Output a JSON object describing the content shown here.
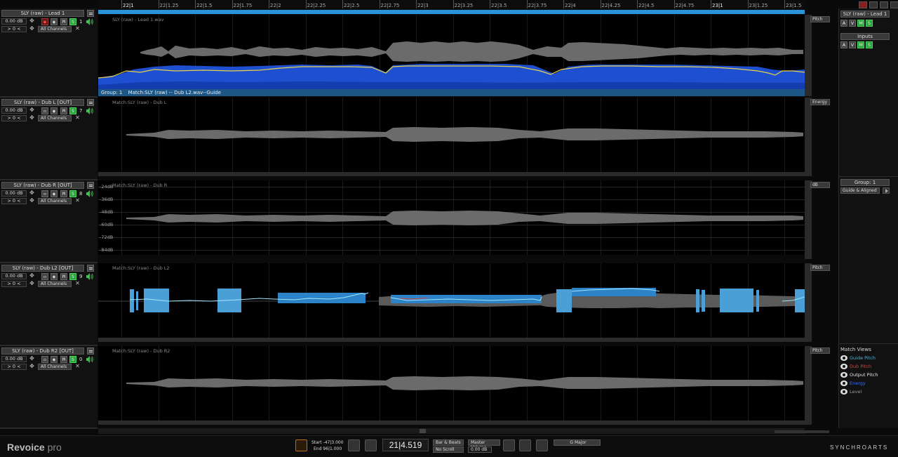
{
  "ruler": {
    "ticks": [
      "22|1",
      "22|1.25",
      "22|1.5",
      "22|1.75",
      "22|2",
      "22|2.25",
      "22|2.5",
      "22|2.75",
      "22|3",
      "22|3.25",
      "22|3.5",
      "22|3.75",
      "22|4",
      "22|4.25",
      "22|4.5",
      "22|4.75",
      "23|1",
      "23|1.25",
      "23|1.5"
    ]
  },
  "tracks": [
    {
      "name": "SLY (raw) - Lead 1",
      "gain": "0.00 dB",
      "pan": "> 0 <",
      "number": "1",
      "channels": "All Channels",
      "caption": "SLY (raw) - Lead 1.wav",
      "view": "Pitch"
    },
    {
      "name": "SLY (raw) - Dub L [OUT]",
      "gain": "0.00 dB",
      "pan": "> 0 <",
      "number": "7",
      "channels": "All Channels",
      "caption": "Match:SLY (raw) - Dub L",
      "view": "Energy"
    },
    {
      "name": "SLY (raw) - Dub R [OUT]",
      "gain": "0.00 dB",
      "pan": "> 0 <",
      "number": "8",
      "channels": "All Channels",
      "caption": "Match:SLY (raw) - Dub R",
      "view": "dB"
    },
    {
      "name": "SLY (raw) - Dub L2 [OUT]",
      "gain": "0.00 dB",
      "pan": "> 0 <",
      "number": "9",
      "channels": "All Channels",
      "caption": "Match:SLY (raw) - Dub L2",
      "view": "Pitch"
    },
    {
      "name": "SLY (raw) - Dub R2 [OUT]",
      "gain": "0.00 dB",
      "pan": "> 0 <",
      "number": "0",
      "channels": "All Channels",
      "caption": "Match:SLY (raw) - Dub R2",
      "view": "Pitch"
    }
  ],
  "buttons": {
    "mute": "M",
    "solo": "S"
  },
  "group_bar": {
    "group": "Group: 1",
    "match": "Match:SLY (raw) -- Dub L2.wav--Guide"
  },
  "db_scale": [
    "-24dB",
    "-36dB",
    "-48dB",
    "-60dB",
    "-72dB",
    "-84dB"
  ],
  "right_panel": {
    "track_title": "SLY (raw) - Lead 1",
    "avs": [
      "A",
      "V",
      "M",
      "S"
    ],
    "inputs_label": "Inputs",
    "inputs_avs": [
      "A",
      "V",
      "M",
      "S"
    ],
    "group_title": "Group: 1",
    "group_mode": "Guide & Aligned",
    "match_views_title": "Match Views",
    "match_views": [
      {
        "label": "Guide Pitch",
        "color": "#4fb6d8"
      },
      {
        "label": "Dub Pitch",
        "color": "#d9453b"
      },
      {
        "label": "Output Pitch",
        "color": "#e6e6e6"
      },
      {
        "label": "Energy",
        "color": "#3c6cf0"
      },
      {
        "label": "Level",
        "color": "#9a9a9a"
      }
    ]
  },
  "bottom": {
    "logo_main": "Revoice",
    "logo_sub": "pro",
    "start": "Start -47|3.000",
    "end": "End 96|1.000",
    "time": "21|4.519",
    "timebase": "Bar & Beats",
    "scroll": "No Scroll",
    "master_label": "Master Volume",
    "master_value": "0.00 dB",
    "key": "G Major",
    "brand": "SYNCHROARTS"
  },
  "colors": {
    "accent": "#2a92d6",
    "energy": "#1e4fd1",
    "guide": "#4fb6d8",
    "solo": "#29a33b"
  }
}
